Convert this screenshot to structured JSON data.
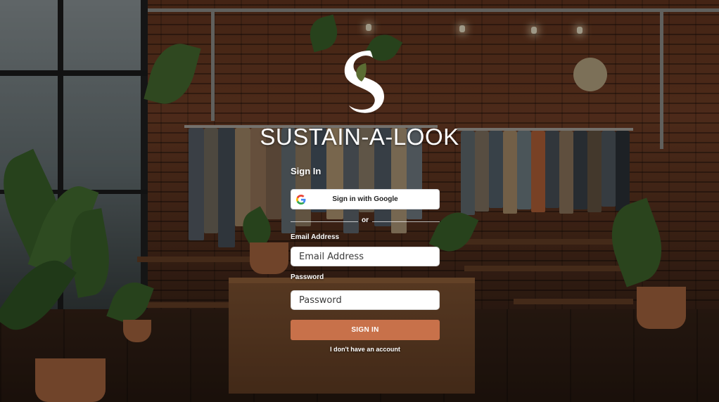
{
  "brand": {
    "name": "SUSTAIN-A-LOOK",
    "logo_icon": "s-leaf-logo-icon"
  },
  "signin": {
    "title": "Sign In",
    "google_button_label": "Sign in with Google",
    "google_icon": "google-g-icon",
    "divider_text": "or",
    "email_label": "Email Address",
    "email_placeholder": "Email Address",
    "email_value": "",
    "password_label": "Password",
    "password_placeholder": "Password",
    "password_value": "",
    "submit_label": "SIGN IN",
    "no_account_link": "I don't have an account"
  },
  "colors": {
    "accent": "#c8714a",
    "text_on_dark": "#ffffff",
    "field_bg": "#ffffff"
  }
}
